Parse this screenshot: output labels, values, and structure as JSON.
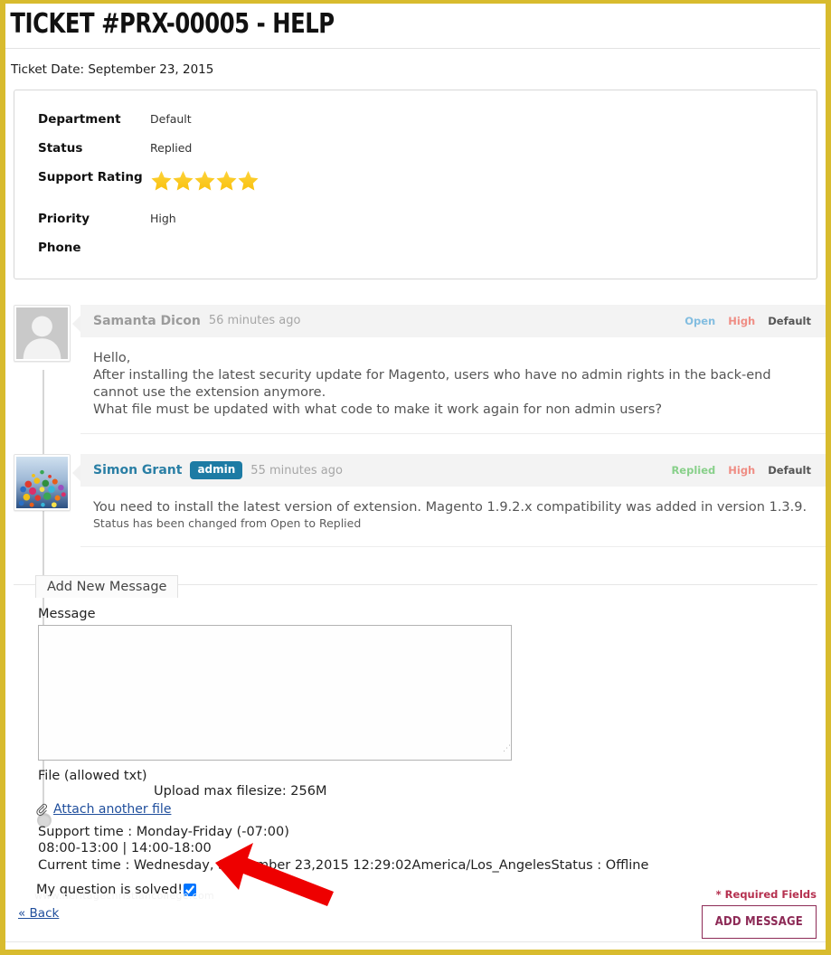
{
  "frame": {
    "border_color": "#d8bb2e"
  },
  "header": {
    "title": "TICKET #PRX-00005 - HELP",
    "ticket_date": "Ticket Date: September 23, 2015"
  },
  "info_card": {
    "rows": [
      {
        "label": "Department",
        "value": "Default"
      },
      {
        "label": "Status",
        "value": "Replied"
      },
      {
        "label": "Support Rating",
        "value": ""
      },
      {
        "label": "Priority",
        "value": "High"
      },
      {
        "label": "Phone",
        "value": ""
      }
    ],
    "rating": {
      "stars_filled": 5,
      "stars_total": 5,
      "star_color": "#f9c10f"
    }
  },
  "conversation": {
    "messages": [
      {
        "author": "Samanta Dicon",
        "badge": "",
        "time_ago": "56 minutes ago",
        "status": "Open",
        "status_color": "#82bde0",
        "priority": "High",
        "department": "Default",
        "avatar_type": "default-silhouette",
        "body_lines": [
          "Hello,",
          "After installing the latest security update for Magento, users who have no admin rights in the back-end cannot use the extension anymore.",
          "What file must be updated with what code to make it work again for non admin users?"
        ],
        "note": ""
      },
      {
        "author": "Simon Grant",
        "badge": "admin",
        "time_ago": "55 minutes ago",
        "status": "Replied",
        "status_color": "#88d08a",
        "priority": "High",
        "department": "Default",
        "avatar_type": "balloons-photo",
        "body_lines": [
          "You need to install the latest version of extension. Magento 1.9.2.x compatibility was added in version 1.3.9."
        ],
        "note": "Status has been changed from Open to Replied"
      }
    ]
  },
  "form": {
    "legend": "Add New Message",
    "message_label": "Message",
    "message_value": "",
    "message_placeholder": "",
    "file_label": "File (allowed txt)",
    "upload_max": "Upload max filesize: 256M",
    "attach_link": "Attach another file",
    "support_time_line1": "Support time : Monday-Friday (-07:00)",
    "support_time_line2": "08:00-13:00 | 14:00-18:00",
    "current_time_line": "Current time :  Wednesday, September 23,2015 12:29:02America/Los_AngelesStatus : Offline",
    "solved_label": "My question is solved!",
    "solved_checked": true
  },
  "annotation": {
    "arrow_color": "#ee0000"
  },
  "footer": {
    "watermark": "www.heritagechristiancollege.com",
    "back_link": "« Back",
    "required_fields": "* Required Fields",
    "add_message_button": "ADD MESSAGE",
    "button_color": "#8d2a56"
  }
}
